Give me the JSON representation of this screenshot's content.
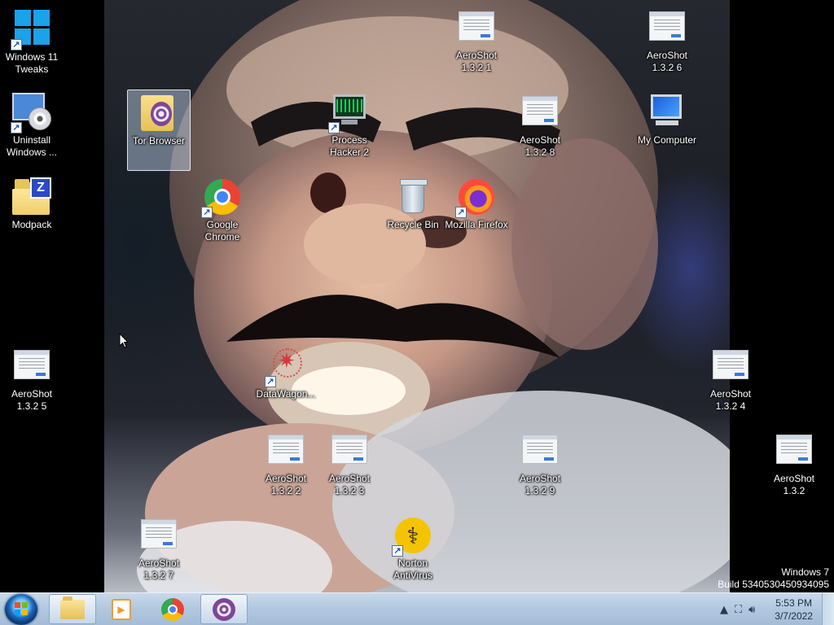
{
  "desktop": {
    "icons": [
      {
        "id": "win11tweaks",
        "label": "Windows 11 Tweaks"
      },
      {
        "id": "uninstall",
        "label": "Uninstall Windows ..."
      },
      {
        "id": "modpack",
        "label": "Modpack"
      },
      {
        "id": "tor",
        "label": "Tor Browser"
      },
      {
        "id": "chrome",
        "label": "Google Chrome"
      },
      {
        "id": "processhacker",
        "label": "Process Hacker 2"
      },
      {
        "id": "recyclebin",
        "label": "Recycle Bin"
      },
      {
        "id": "firefox",
        "label": "Mozilla Firefox"
      },
      {
        "id": "mycomputer",
        "label": "My Computer"
      },
      {
        "id": "aero1321",
        "label": "AeroShot 1.3.2 1"
      },
      {
        "id": "aero1326",
        "label": "AeroShot 1.3.2 6"
      },
      {
        "id": "aero1328",
        "label": "AeroShot 1.3.2 8"
      },
      {
        "id": "aero1325",
        "label": "AeroShot 1.3.2 5"
      },
      {
        "id": "datawagon",
        "label": "DataWagon..."
      },
      {
        "id": "aero1324",
        "label": "AeroShot 1.3.2 4"
      },
      {
        "id": "aero1322",
        "label": "AeroShot 1.3.2 2"
      },
      {
        "id": "aero1323",
        "label": "AeroShot 1.3.2 3"
      },
      {
        "id": "aero1329",
        "label": "AeroShot 1.3.2 9"
      },
      {
        "id": "aero132",
        "label": "AeroShot 1.3.2"
      },
      {
        "id": "aero1327",
        "label": "AeroShot 1.3.2 7"
      },
      {
        "id": "norton",
        "label": "Norton AntiVirus"
      }
    ],
    "selected_icon": "Tor Browser"
  },
  "watermark": {
    "line1": "Windows 7",
    "line2": "Build 5340530450934095"
  },
  "taskbar": {
    "pinned": [
      "Windows Explorer",
      "Windows Media Player",
      "Google Chrome",
      "Tor Browser"
    ],
    "active_item": "Tor Browser",
    "tray": {
      "time": "5:53 PM",
      "date": "3/7/2022"
    }
  },
  "icons": {
    "start": "windows-start-orb",
    "tray_show_hidden": "chevron-up-icon",
    "tray_network": "network-icon",
    "tray_volume": "volume-icon"
  },
  "colors": {
    "taskbar": "#b3c9e0",
    "desktop_bg": "#000000",
    "selection": "#c8dcf5"
  }
}
